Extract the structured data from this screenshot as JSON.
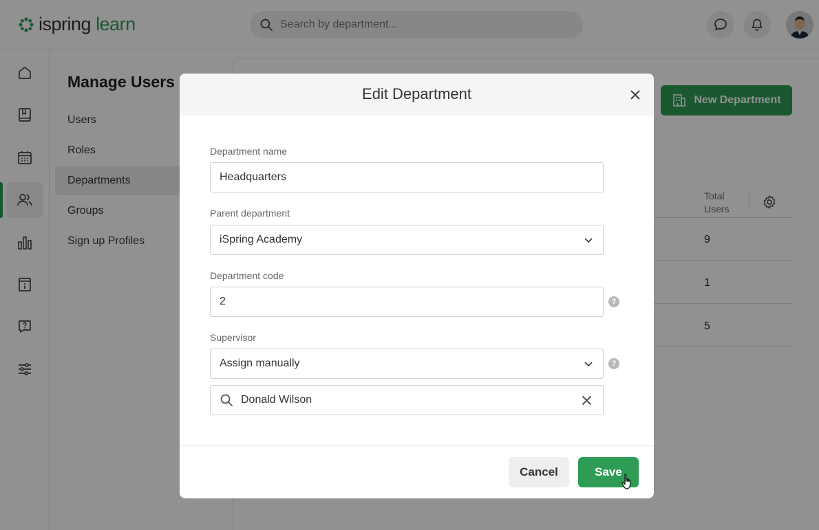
{
  "app": {
    "logo_brand": "ispring",
    "logo_product": "learn",
    "search_placeholder": "Search by department...",
    "accent_color": "#2e9c55"
  },
  "left_rail": {
    "items": [
      {
        "icon": "home-icon"
      },
      {
        "icon": "book-icon"
      },
      {
        "icon": "calendar-icon"
      },
      {
        "icon": "users-icon",
        "active": true
      },
      {
        "icon": "reports-icon"
      },
      {
        "icon": "info-board-icon"
      },
      {
        "icon": "help-chat-icon"
      },
      {
        "icon": "settings-sliders-icon"
      }
    ]
  },
  "subnav": {
    "title": "Manage Users",
    "items": [
      {
        "label": "Users"
      },
      {
        "label": "Roles"
      },
      {
        "label": "Departments",
        "active": true
      },
      {
        "label": "Groups"
      },
      {
        "label": "Sign up Profiles"
      }
    ]
  },
  "main": {
    "new_department_label": "New Department",
    "column_total_users": "Total Users",
    "rows": [
      {
        "total_users": "9"
      },
      {
        "total_users": "1"
      },
      {
        "total_users": "5"
      }
    ]
  },
  "modal": {
    "title": "Edit Department",
    "department_name_label": "Department name",
    "department_name_value": "Headquarters",
    "parent_department_label": "Parent department",
    "parent_department_value": "iSpring Academy",
    "department_code_label": "Department code",
    "department_code_value": "2",
    "supervisor_label": "Supervisor",
    "supervisor_mode_value": "Assign manually",
    "supervisor_search_value": "Donald Wilson",
    "cancel_label": "Cancel",
    "save_label": "Save"
  }
}
